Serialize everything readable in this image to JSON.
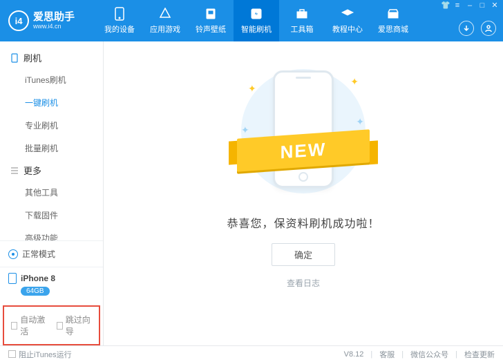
{
  "header": {
    "brand": "爱思助手",
    "brand_url": "www.i4.cn",
    "nav": [
      {
        "label": "我的设备",
        "icon": "phone-icon"
      },
      {
        "label": "应用游戏",
        "icon": "apps-icon"
      },
      {
        "label": "铃声壁纸",
        "icon": "music-icon"
      },
      {
        "label": "智能刷机",
        "icon": "flash-icon",
        "active": true
      },
      {
        "label": "工具箱",
        "icon": "toolbox-icon"
      },
      {
        "label": "教程中心",
        "icon": "tutorial-icon"
      },
      {
        "label": "爱思商城",
        "icon": "shop-icon"
      }
    ]
  },
  "sidebar": {
    "groups": [
      {
        "label": "刷机",
        "icon": "phone-icon",
        "items": [
          {
            "label": "iTunes刷机"
          },
          {
            "label": "一键刷机",
            "active": true
          },
          {
            "label": "专业刷机"
          },
          {
            "label": "批量刷机"
          }
        ]
      },
      {
        "label": "更多",
        "icon": "list-icon",
        "items": [
          {
            "label": "其他工具"
          },
          {
            "label": "下载固件"
          },
          {
            "label": "高级功能"
          }
        ]
      }
    ],
    "status_label": "正常模式",
    "device": {
      "name": "iPhone 8",
      "capacity": "64GB"
    },
    "checks": [
      {
        "label": "自动激活"
      },
      {
        "label": "跳过向导"
      }
    ]
  },
  "main": {
    "ribbon": "NEW",
    "success_text": "恭喜您，保资料刷机成功啦！",
    "ok_button": "确定",
    "log_link": "查看日志"
  },
  "footer": {
    "block_itunes": "阻止iTunes运行",
    "version": "V8.12",
    "support": "客服",
    "wechat": "微信公众号",
    "update": "检查更新"
  }
}
